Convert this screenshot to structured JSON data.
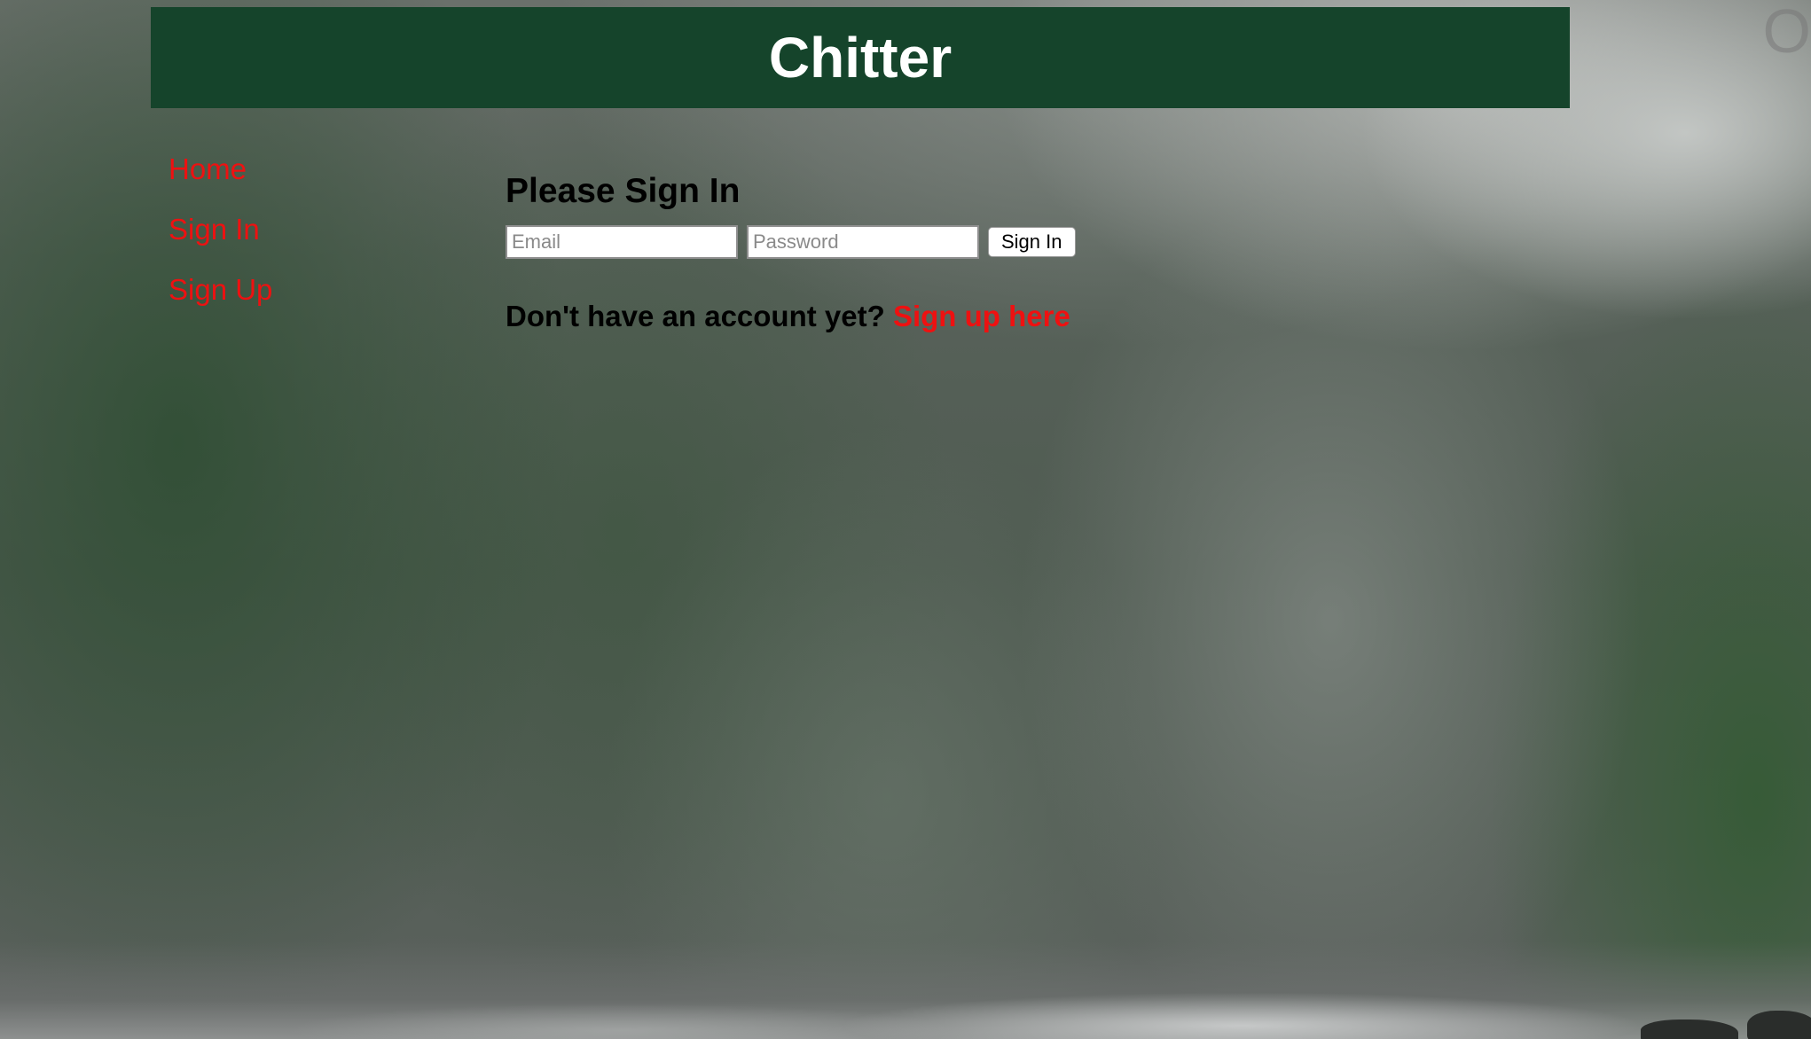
{
  "app": {
    "title": "Chitter"
  },
  "nav": {
    "items": [
      {
        "label": "Home"
      },
      {
        "label": "Sign In"
      },
      {
        "label": "Sign Up"
      }
    ]
  },
  "signin": {
    "heading": "Please Sign In",
    "email_placeholder": "Email",
    "password_placeholder": "Password",
    "button_label": "Sign In",
    "no_account_text": "Don't have an account yet?",
    "signup_link_label": "Sign up here"
  },
  "background": {
    "corner_text": "O"
  },
  "colors": {
    "header_bg": "#15442b",
    "link": "#ee1111",
    "header_text": "#ffffff"
  }
}
